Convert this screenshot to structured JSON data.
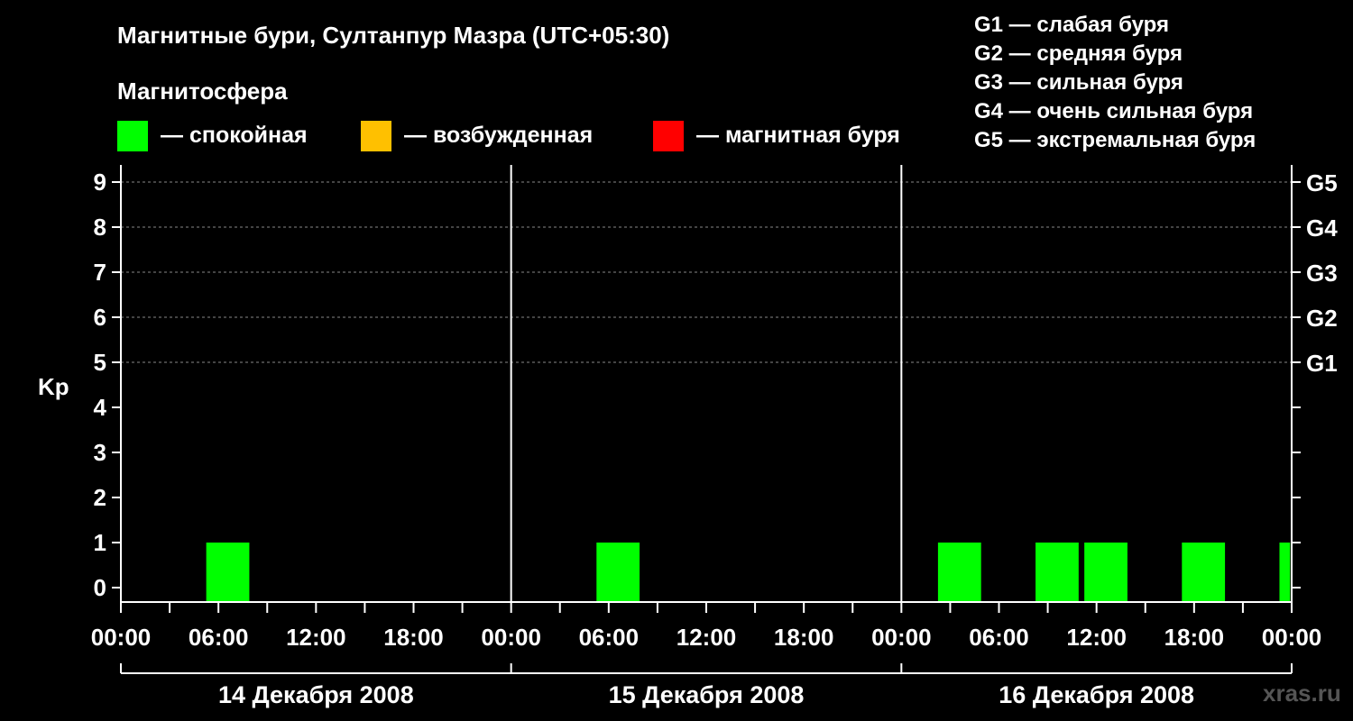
{
  "header": {
    "title": "Магнитные бури, Султанпур Мазра (UTC+05:30)",
    "magnetosphere_label": "Магнитосфера"
  },
  "legend": [
    {
      "label": "— спокойная",
      "color": "#00ff00"
    },
    {
      "label": "— возбужденная",
      "color": "#ffc000"
    },
    {
      "label": "— магнитная буря",
      "color": "#ff0000"
    }
  ],
  "g_scale": [
    "G1 — слабая буря",
    "G2 — средняя буря",
    "G3 — сильная буря",
    "G4 — очень сильная буря",
    "G5 — экстремальная буря"
  ],
  "watermark": "xras.ru",
  "chart_data": {
    "type": "bar",
    "ylabel": "Kp",
    "ylim": [
      0,
      9
    ],
    "yticks": [
      "0",
      "1",
      "2",
      "3",
      "4",
      "5",
      "6",
      "7",
      "8",
      "9"
    ],
    "right_ticks": [
      {
        "kp": 5,
        "label": "G1"
      },
      {
        "kp": 6,
        "label": "G2"
      },
      {
        "kp": 7,
        "label": "G3"
      },
      {
        "kp": 8,
        "label": "G4"
      },
      {
        "kp": 9,
        "label": "G5"
      }
    ],
    "x_tick_labels": [
      "00:00",
      "06:00",
      "12:00",
      "18:00",
      "00:00",
      "06:00",
      "12:00",
      "18:00",
      "00:00",
      "06:00",
      "12:00",
      "18:00",
      "00:00"
    ],
    "days": [
      "14 Декабря 2008",
      "15 Декабря 2008",
      "16 Декабря 2008"
    ],
    "grid": true,
    "series": [
      {
        "values": [
          {
            "start_hour": 5.25,
            "end_hour": 7.9,
            "kp": 1
          },
          {
            "start_hour": 29.25,
            "end_hour": 31.9,
            "kp": 1
          },
          {
            "start_hour": 50.25,
            "end_hour": 52.9,
            "kp": 1
          },
          {
            "start_hour": 56.25,
            "end_hour": 58.9,
            "kp": 1
          },
          {
            "start_hour": 59.25,
            "end_hour": 61.9,
            "kp": 1
          },
          {
            "start_hour": 65.25,
            "end_hour": 67.9,
            "kp": 1
          },
          {
            "start_hour": 71.25,
            "end_hour": 71.9,
            "kp": 1
          }
        ],
        "color": "#00ff00"
      }
    ]
  }
}
